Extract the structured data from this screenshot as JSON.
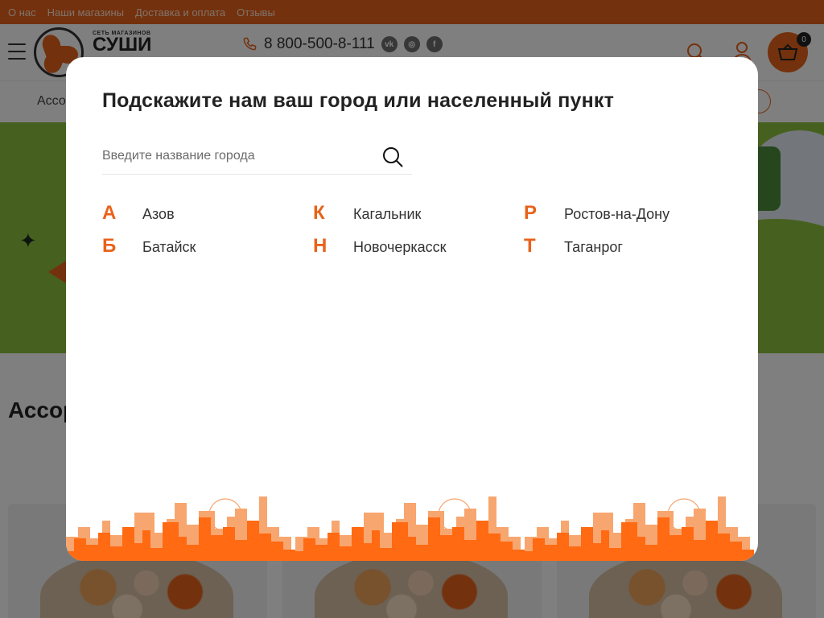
{
  "topbar": {
    "links": [
      "О нас",
      "Наши магазины",
      "Доставка и оплата",
      "Отзывы"
    ]
  },
  "header": {
    "logo_small": "СЕТЬ МАГАЗИНОВ",
    "logo_big": "СУШИ",
    "phone": "8 800-500-8-111",
    "social": [
      "vk-icon",
      "instagram-icon",
      "facebook-icon"
    ],
    "cart_count": "0"
  },
  "nav": {
    "first_item": "Ассо",
    "pill": "м"
  },
  "page": {
    "section_title": "Ассор"
  },
  "modal": {
    "title": "Подскажите нам ваш город или населенный пункт",
    "search_placeholder": "Введите название города",
    "groups": [
      {
        "letter": "А",
        "city": "Азов"
      },
      {
        "letter": "Б",
        "city": "Батайск"
      },
      {
        "letter": "К",
        "city": "Кагальник"
      },
      {
        "letter": "Н",
        "city": "Новочеркасск"
      },
      {
        "letter": "Р",
        "city": "Ростов-на-Дону"
      },
      {
        "letter": "Т",
        "city": "Таганрог"
      }
    ]
  },
  "colors": {
    "accent": "#e8621a",
    "banner": "#8dc33f",
    "overlay": "rgba(0,0,0,0.5)"
  }
}
